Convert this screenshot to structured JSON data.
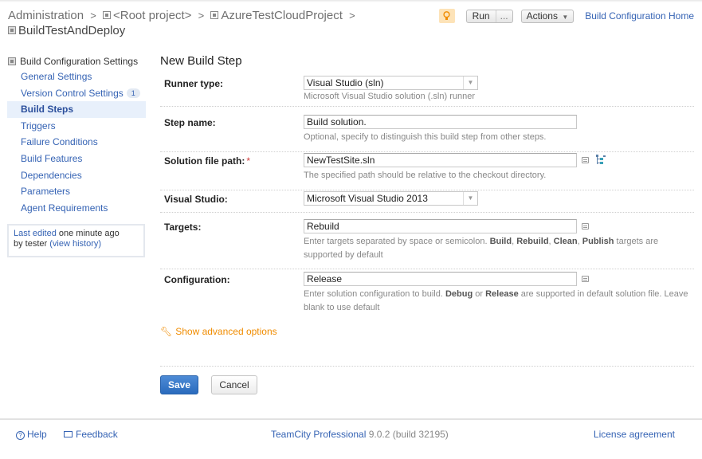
{
  "header": {
    "breadcrumb": [
      {
        "label": "Administration",
        "icon": null
      },
      {
        "label": "<Root project>",
        "icon": "project-icon"
      },
      {
        "label": "AzureTestCloudProject",
        "icon": "project-icon"
      }
    ],
    "separator": ">",
    "build_config": "BuildTestAndDeploy",
    "run_label": "Run",
    "run_more_label": "...",
    "actions_label": "Actions",
    "home_link": "Build Configuration Home",
    "accent_color": "#3563b4"
  },
  "sidebar": {
    "title": "Build Configuration Settings",
    "items": [
      {
        "label": "General Settings",
        "active": false
      },
      {
        "label": "Version Control Settings",
        "badge": "1",
        "active": false
      },
      {
        "label": "Build Steps",
        "active": true
      },
      {
        "label": "Triggers",
        "active": false
      },
      {
        "label": "Failure Conditions",
        "active": false
      },
      {
        "label": "Build Features",
        "active": false
      },
      {
        "label": "Dependencies",
        "active": false
      },
      {
        "label": "Parameters",
        "active": false
      },
      {
        "label": "Agent Requirements",
        "active": false
      }
    ],
    "edit_info": {
      "last_edited_link": "Last edited",
      "time_text": " one minute ago",
      "by_text": "by tester ",
      "history_link": "(view history)"
    }
  },
  "form": {
    "title": "New Build Step",
    "runner_type": {
      "label": "Runner type:",
      "value": "Visual Studio (sln)",
      "hint": "Microsoft Visual Studio solution (.sln) runner"
    },
    "step_name": {
      "label": "Step name:",
      "value": "Build solution.",
      "hint": "Optional, specify to distinguish this build step from other steps."
    },
    "solution_path": {
      "label": "Solution file path:",
      "required_mark": "*",
      "value": "NewTestSite.sln",
      "hint": "The specified path should be relative to the checkout directory."
    },
    "visual_studio": {
      "label": "Visual Studio:",
      "value": "Microsoft Visual Studio 2013"
    },
    "targets": {
      "label": "Targets:",
      "value": "Rebuild",
      "hint_prefix": "Enter targets separated by space or semicolon. ",
      "hint_b1": "Build",
      "hint_c1": ", ",
      "hint_b2": "Rebuild",
      "hint_c2": ", ",
      "hint_b3": "Clean",
      "hint_c3": ", ",
      "hint_b4": "Publish",
      "hint_suffix": " targets are supported by default"
    },
    "configuration": {
      "label": "Configuration:",
      "value": "Release",
      "hint_prefix": "Enter solution configuration to build. ",
      "hint_b1": "Debug",
      "hint_mid": " or ",
      "hint_b2": "Release",
      "hint_suffix": " are supported in default solution file. Leave blank to use default"
    },
    "advanced_link": "Show advanced options",
    "save_label": "Save",
    "cancel_label": "Cancel"
  },
  "footer": {
    "help": "Help",
    "feedback": "Feedback",
    "product": "TeamCity Professional",
    "version": " 9.0.2 (build 32195)",
    "license": "License agreement"
  }
}
